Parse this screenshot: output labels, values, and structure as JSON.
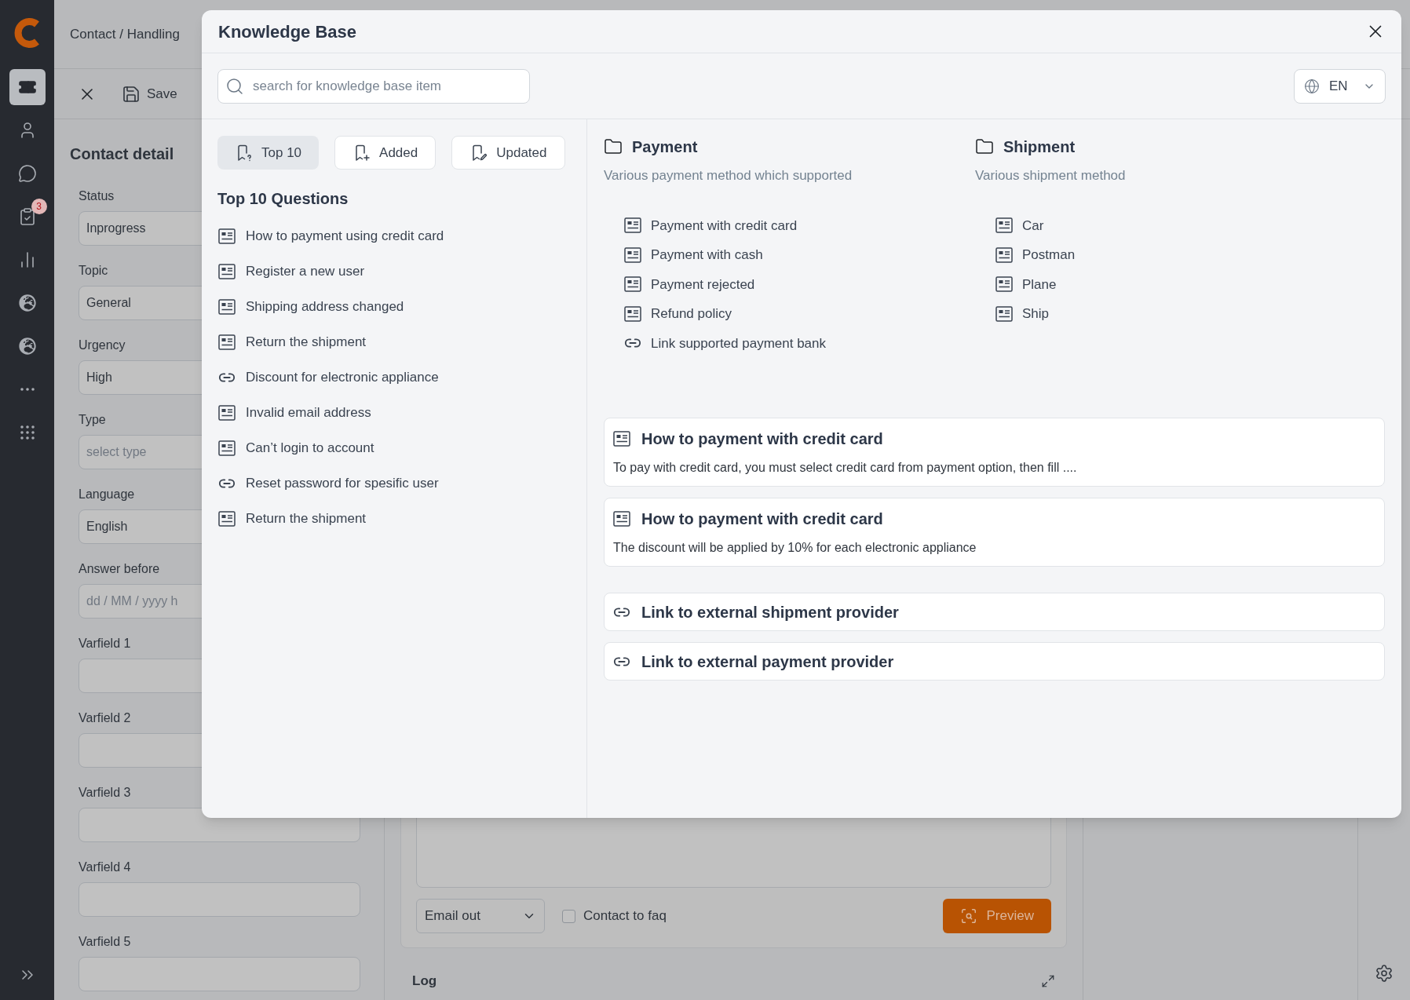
{
  "sidebar": {
    "items": [
      {
        "kind": "tickets",
        "selected": true
      },
      {
        "kind": "contacts",
        "selected": false
      },
      {
        "kind": "chat",
        "selected": false
      },
      {
        "kind": "tasks",
        "selected": false,
        "badge": "3"
      },
      {
        "kind": "reports",
        "selected": false
      },
      {
        "kind": "globe",
        "selected": false
      },
      {
        "kind": "globe",
        "selected": false
      },
      {
        "kind": "more",
        "selected": false
      },
      {
        "kind": "apps",
        "selected": false
      }
    ]
  },
  "breadcrumb": "Contact / Handling",
  "toolbar": {
    "save": "Save"
  },
  "contact_detail": {
    "title": "Contact detail",
    "fields": [
      {
        "label": "Status",
        "value": "Inprogress"
      },
      {
        "label": "Topic",
        "value": "General"
      },
      {
        "label": "Urgency",
        "value": "High"
      },
      {
        "label": "Type",
        "placeholder": "select type"
      },
      {
        "label": "Language",
        "value": "English"
      },
      {
        "label": "Answer before",
        "placeholder": "dd / MM / yyyy h"
      },
      {
        "label": "Varfield 1"
      },
      {
        "label": "Varfield 2"
      },
      {
        "label": "Varfield 3"
      },
      {
        "label": "Varfield 4"
      },
      {
        "label": "Varfield 5"
      }
    ]
  },
  "composer": {
    "channel": "Email out",
    "faq": {
      "label": "Contact to faq",
      "checked": false
    },
    "preview": "Preview"
  },
  "log": {
    "title": "Log"
  },
  "knowledge_base": {
    "title": "Knowledge Base",
    "search": {
      "placeholder": "search for knowledge base item"
    },
    "language": "EN",
    "tabs": [
      {
        "kind": "top",
        "label": "Top 10",
        "selected": true
      },
      {
        "kind": "added",
        "label": "Added",
        "selected": false
      },
      {
        "kind": "updated",
        "label": "Updated",
        "selected": false
      }
    ],
    "list_title": "Top 10 Questions",
    "questions": [
      {
        "kind": "article",
        "text": "How to payment using credit card"
      },
      {
        "kind": "article",
        "text": "Register a new user"
      },
      {
        "kind": "article",
        "text": "Shipping address changed"
      },
      {
        "kind": "article",
        "text": "Return the shipment"
      },
      {
        "kind": "link",
        "text": "Discount for electronic appliance"
      },
      {
        "kind": "article",
        "text": "Invalid email address"
      },
      {
        "kind": "article",
        "text": "Can’t login to account"
      },
      {
        "kind": "link",
        "text": "Reset password for spesific user"
      },
      {
        "kind": "article",
        "text": "Return the shipment"
      }
    ],
    "categories": [
      {
        "title": "Payment",
        "description": "Various payment method which supported",
        "items": [
          {
            "kind": "article",
            "text": "Payment with credit card"
          },
          {
            "kind": "article",
            "text": "Payment with cash"
          },
          {
            "kind": "article",
            "text": "Payment rejected"
          },
          {
            "kind": "article",
            "text": "Refund policy"
          },
          {
            "kind": "link",
            "text": "Link supported payment bank"
          }
        ]
      },
      {
        "title": "Shipment",
        "description": "Various shipment method",
        "items": [
          {
            "kind": "article",
            "text": "Car"
          },
          {
            "kind": "article",
            "text": "Postman"
          },
          {
            "kind": "article",
            "text": "Plane"
          },
          {
            "kind": "article",
            "text": "Ship"
          }
        ]
      }
    ],
    "articles": [
      {
        "kind": "article",
        "title": "How to payment with credit card",
        "excerpt": "To pay with credit card, you must select credit card from payment option, then fill ...."
      },
      {
        "kind": "article",
        "title": "How to payment with credit card",
        "excerpt": "The discount will be applied by 10% for each electronic appliance"
      },
      {
        "kind": "link",
        "title": "Link to external shipment provider"
      },
      {
        "kind": "link",
        "title": "Link to external payment provider"
      }
    ]
  }
}
